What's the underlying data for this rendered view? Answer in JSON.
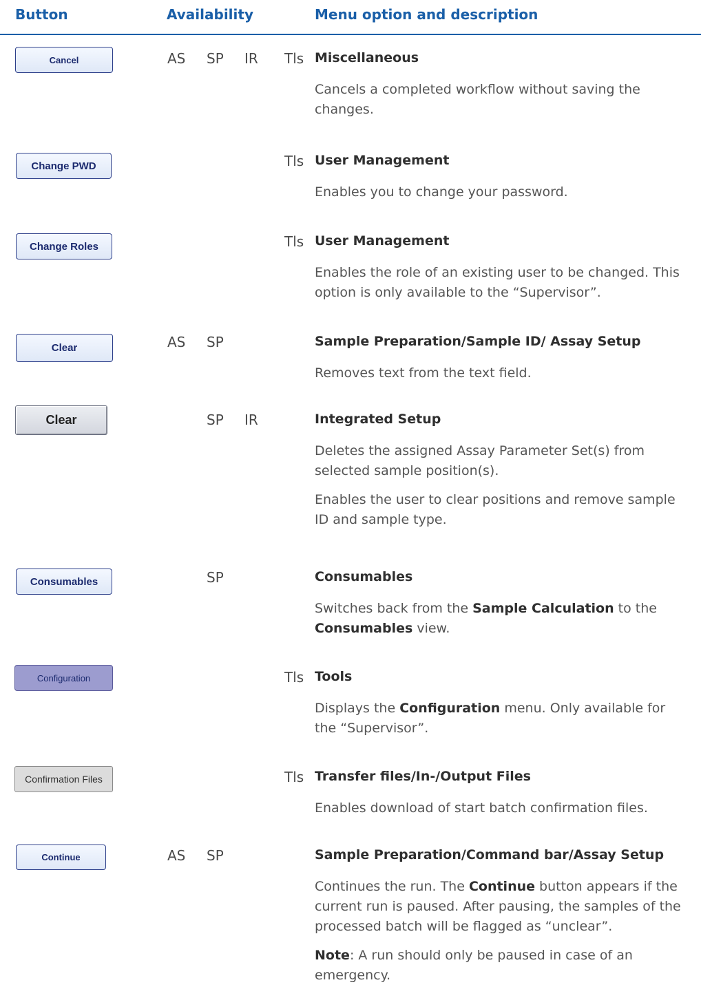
{
  "headers": {
    "button": "Button",
    "availability": "Availability",
    "menu": "Menu option and description"
  },
  "rows": [
    {
      "button": "Cancel",
      "as": "AS",
      "sp": "SP",
      "ir": "IR",
      "tls": "Tls",
      "category": "Miscellaneous",
      "desc1": "Cancels a completed workflow without saving the changes."
    },
    {
      "button": "Change PWD",
      "tls": "Tls",
      "category": "User Management",
      "desc1": "Enables you to change your password."
    },
    {
      "button": "Change Roles",
      "tls": "Tls",
      "category": "User Management",
      "desc1": "Enables the role of an existing user to be changed. This option is only available to the “Supervisor”."
    },
    {
      "button": "Clear",
      "as": "AS",
      "sp": "SP",
      "category": "Sample Preparation/Sample ID/ Assay Setup",
      "desc1": "Removes text from the text field."
    },
    {
      "button": "Clear",
      "sp": "SP",
      "ir": "IR",
      "category": "Integrated Setup",
      "desc1": "Deletes the assigned Assay Parameter Set(s) from selected sample position(s).",
      "desc2": "Enables the user to clear positions and remove sample ID and sample type."
    },
    {
      "button": "Consumables",
      "sp": "SP",
      "category": "Consumables",
      "desc_a": "Switches back from the ",
      "desc_b": "Sample Calculation",
      "desc_c": " to the ",
      "desc_d": "Consumables",
      "desc_e": " view."
    },
    {
      "button": "Configuration",
      "tls": "Tls",
      "category": "Tools",
      "desc_a": "Displays the ",
      "desc_b": "Configuration",
      "desc_c": " menu. Only available for the “Supervisor”."
    },
    {
      "button": "Confirmation Files",
      "tls": "Tls",
      "category": "Transfer files/In-/Output Files",
      "desc1": "Enables download of start batch confirmation files."
    },
    {
      "button": "Continue",
      "as": "AS",
      "sp": "SP",
      "category": "Sample Preparation/Command bar/Assay Setup",
      "desc_a": "Continues the run. The ",
      "desc_b": "Continue",
      "desc_c": " button appears if the current run is paused. After pausing, the samples of the processed batch will be flagged as “unclear”.",
      "note_label": "Note",
      "note_text": ": A run should only be paused in case of an emergency."
    }
  ]
}
